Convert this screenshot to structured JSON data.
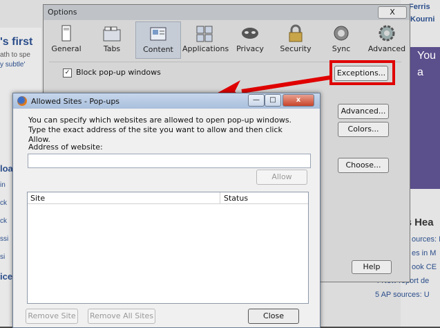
{
  "background": {
    "headline_fragment": "'s first",
    "snippet_1": "ath to spe",
    "snippet_2": "y subtle'",
    "right_1": "Ferris",
    "right_2": "Kourni",
    "right_purple_1": "You",
    "right_purple_2": "a",
    "right_heading": "'s Hea",
    "right_list": [
      "ources: I",
      "es in M",
      "ook CE",
      "4 New report de",
      "5 AP sources: U"
    ],
    "left_frag": [
      "loa",
      "in",
      "ck",
      "ck",
      "ssi",
      "si",
      "ice"
    ]
  },
  "options_dialog": {
    "title": "Options",
    "close_label": "X",
    "tabs": [
      {
        "label": "General",
        "icon": "general-icon"
      },
      {
        "label": "Tabs",
        "icon": "tabs-icon"
      },
      {
        "label": "Content",
        "icon": "content-icon",
        "active": true
      },
      {
        "label": "Applications",
        "icon": "applications-icon"
      },
      {
        "label": "Privacy",
        "icon": "privacy-mask-icon"
      },
      {
        "label": "Security",
        "icon": "security-lock-icon"
      },
      {
        "label": "Sync",
        "icon": "sync-icon"
      },
      {
        "label": "Advanced",
        "icon": "advanced-gear-icon"
      }
    ],
    "block_popups_label": "Block pop-up windows",
    "block_popups_checked": true,
    "exceptions_label": "Exceptions...",
    "advanced_label": "Advanced...",
    "colors_label": "Colors...",
    "choose_label": "Choose...",
    "help_label": "Help"
  },
  "allowed_dialog": {
    "title": "Allowed Sites - Pop-ups",
    "description": "You can specify which websites are allowed to open pop-up windows. Type the exact address of the site you want to allow and then click Allow.",
    "address_label": "Address of website:",
    "address_value": "",
    "allow_label": "Allow",
    "columns": {
      "site": "Site",
      "status": "Status"
    },
    "rows": [],
    "remove_site_label": "Remove Site",
    "remove_all_label": "Remove All Sites",
    "close_label": "Close",
    "window_buttons": {
      "minimize": "—",
      "maximize": "□",
      "close": "x"
    }
  },
  "colors": {
    "highlight": "#e00000",
    "arrow": "#e00000"
  }
}
